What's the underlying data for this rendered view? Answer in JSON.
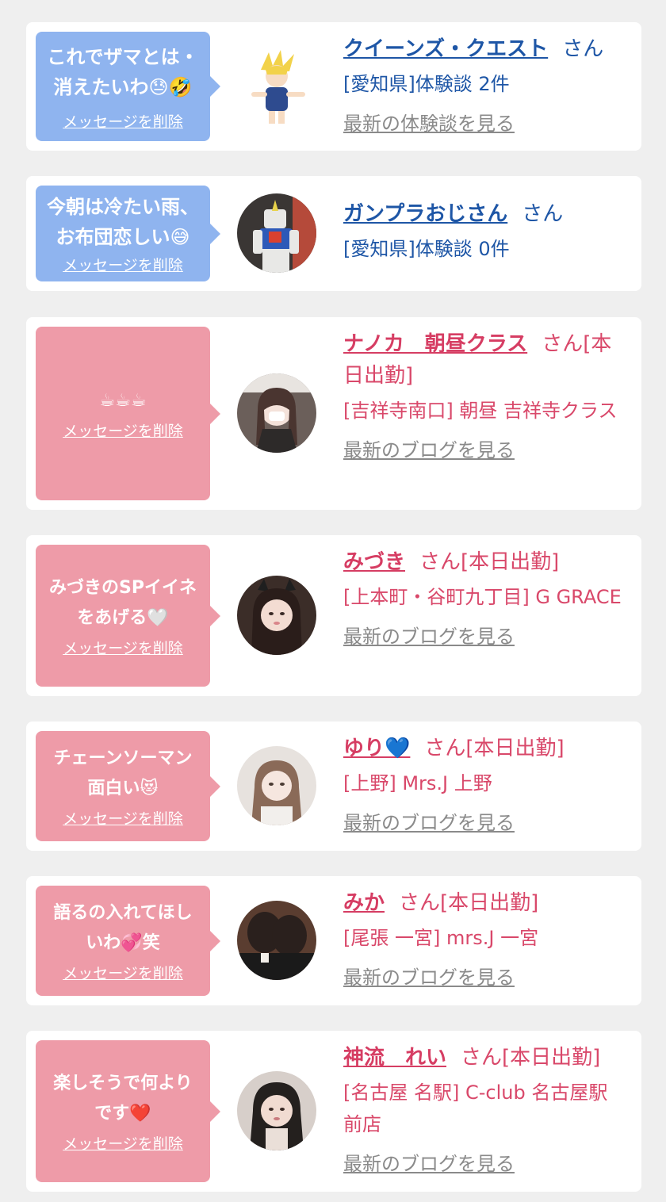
{
  "cards": [
    {
      "message": "これでザマとは・\n消えたいわ😓🤣",
      "delete_label": "メッセージを削除",
      "name": "クイーンズ・クエスト",
      "suffix": "さん",
      "area": "[愛知県]体験談 2件",
      "link": "最新の体験談を見る",
      "avatar_icon": "anime-character-avatar-icon"
    },
    {
      "message": "今朝は冷たい雨、\nお布団恋しい😅",
      "delete_label": "メッセージを削除",
      "name": "ガンプラおじさん",
      "suffix": "さん",
      "area": "[愛知県]体験談 0件",
      "link": "",
      "avatar_icon": "robot-figure-avatar-icon"
    },
    {
      "message": "☕☕☕",
      "delete_label": "メッセージを削除",
      "name": "ナノカ　朝昼クラス",
      "suffix": "さん[本日出勤]",
      "area": "[吉祥寺南口] 朝昼 吉祥寺クラス",
      "link": "最新のブログを見る",
      "avatar_icon": "girl-photo-avatar-icon"
    },
    {
      "message": "みづきのSPイイネ\nをあげる🤍",
      "delete_label": "メッセージを削除",
      "name": "みづき",
      "suffix": "さん[本日出勤]",
      "area": "[上本町・谷町九丁目] G GRACE",
      "link": "最新のブログを見る",
      "avatar_icon": "girl-photo-avatar-icon"
    },
    {
      "message": "チェーンソーマン\n面白い😻",
      "delete_label": "メッセージを削除",
      "name": "ゆり",
      "name_heart": "💙",
      "suffix": "さん[本日出勤]",
      "area": "[上野] Mrs.J 上野",
      "link": "最新のブログを見る",
      "avatar_icon": "girl-photo-avatar-icon"
    },
    {
      "message": "語るの入れてほし\nいわ💞笑",
      "delete_label": "メッセージを削除",
      "name": "みか",
      "suffix": "さん[本日出勤]",
      "area": "[尾張 一宮] mrs.J 一宮",
      "link": "最新のブログを見る",
      "avatar_icon": "girl-photo-avatar-icon"
    },
    {
      "message": "楽しそうで何より\nです❤️",
      "delete_label": "メッセージを削除",
      "name": "神流　れい",
      "suffix": "さん[本日出勤]",
      "area": "[名古屋 名駅] C-club 名古屋駅前店",
      "link": "最新のブログを見る",
      "avatar_icon": "girl-photo-avatar-icon"
    }
  ]
}
